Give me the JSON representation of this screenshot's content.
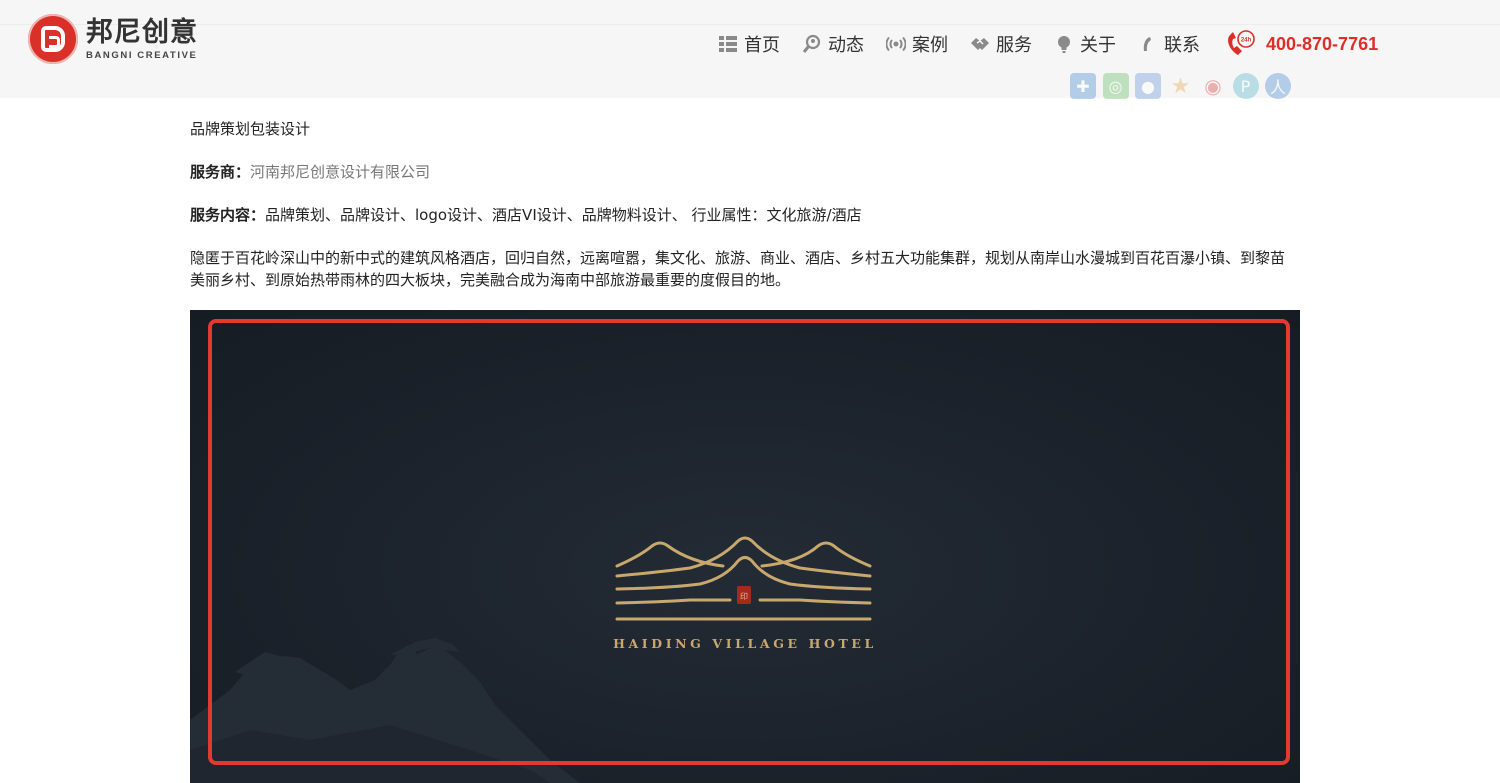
{
  "brand": {
    "name_cn": "邦尼创意",
    "name_en": "BANGNI  CREATIVE",
    "accent": "#d9302a"
  },
  "nav": {
    "items": [
      {
        "label": "首页",
        "icon": "grid-icon"
      },
      {
        "label": "动态",
        "icon": "magnifier-user-icon"
      },
      {
        "label": "案例",
        "icon": "broadcast-icon"
      },
      {
        "label": "服务",
        "icon": "handshake-icon"
      },
      {
        "label": "关于",
        "icon": "bulb-icon"
      },
      {
        "label": "联系",
        "icon": "handset-icon"
      }
    ],
    "phone": "400-870-7761",
    "phone_icon": "24h-phone-icon"
  },
  "share_icons": [
    "qzone-icon",
    "wechat-icon",
    "qq-icon",
    "favorite-star-icon",
    "weibo-icon",
    "pinterest-icon",
    "renren-icon"
  ],
  "article": {
    "title": "品牌策划包装设计",
    "vendor_label": "服务商：",
    "vendor_name": "河南邦尼创意设计有限公司",
    "service_label": "服务内容：",
    "service_value": "品牌策划、品牌设计、logo设计、酒店VI设计、品牌物料设计、 行业属性：文化旅游/酒店",
    "description": "隐匿于百花岭深山中的新中式的建筑风格酒店，回归自然，远离喧嚣，集文化、旅游、商业、酒店、乡村五大功能集群，规划从南岸山水漫城到百花百瀑小镇、到黎苗美丽乡村、到原始热带雨林的四大板块，完美融合成为海南中部旅游最重要的度假目的地。"
  },
  "hero": {
    "hotel_name": "HAIDING VILLAGE HOTEL",
    "background": "#1a212a",
    "gold": "#c9a86e",
    "frame_color": "#e33a30"
  }
}
